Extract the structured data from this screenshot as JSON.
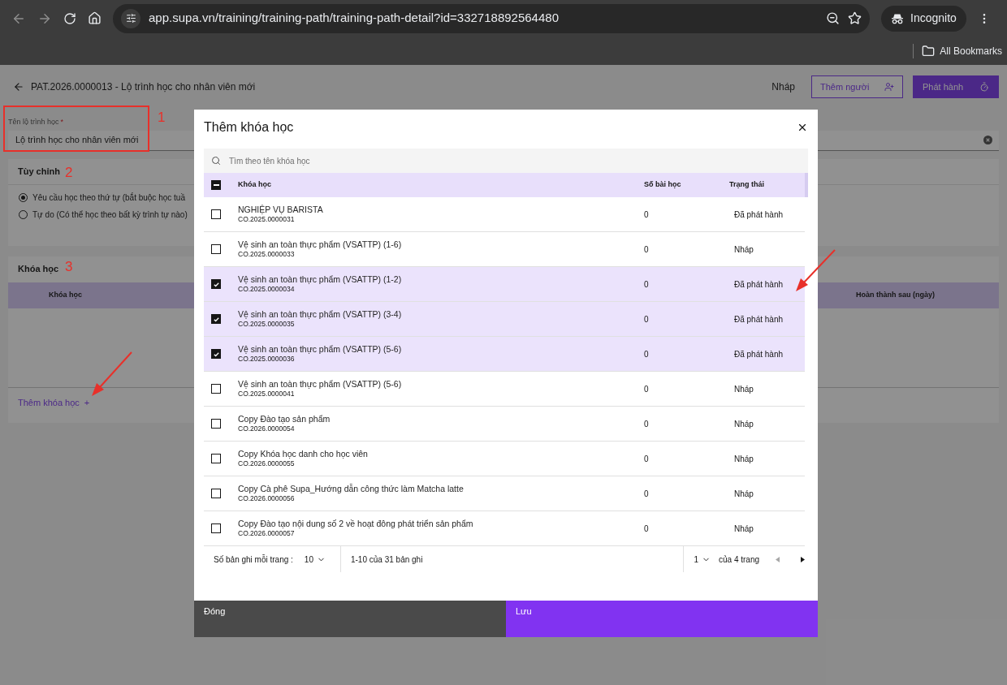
{
  "browser": {
    "url": "app.supa.vn/training/training-path/training-path-detail?id=332718892564480",
    "profile": "Incognito",
    "bookmarks": "All Bookmarks"
  },
  "page": {
    "title": "PAT.2026.0000013 - Lộ trình học cho nhân viên mới",
    "status": "Nháp",
    "add_people_button": "Thêm người",
    "publish_button": "Phát hành",
    "name_field": {
      "label": "Tên lộ trình học",
      "required_mark": "*",
      "value": "Lộ trình học cho nhân viên mới",
      "annotation_number": "1"
    },
    "options_card": {
      "title": "Tùy chỉnh",
      "annotation_number": "2",
      "options": [
        {
          "label": "Yêu cầu học theo thứ tự (bắt buộc học tuầ",
          "selected": true
        },
        {
          "label": "Tự do (Có thể học theo bất kỳ trình tự nào)",
          "selected": false
        }
      ]
    },
    "courses_card": {
      "title": "Khóa học",
      "annotation_number": "3",
      "columns": [
        "Khóa học",
        "Hoàn thành sau (ngày)"
      ],
      "add_link": "Thêm khóa học",
      "add_icon": "+"
    }
  },
  "dialog": {
    "title": "Thêm khóa học",
    "search": {
      "placeholder": "Tìm theo tên khóa học"
    },
    "select_all": {
      "indeterminate": true
    },
    "columns": [
      "Khóa học",
      "Số bài học",
      "Trạng thái"
    ],
    "rows": [
      {
        "name": "NGHIỆP VỤ BARISTA",
        "code": "CO.2025.0000031",
        "lessons": "0",
        "status": "Đã phát hành",
        "selected": false
      },
      {
        "name": "Vệ sinh an toàn thực phẩm (VSATTP) (1-6)",
        "code": "CO.2025.0000033",
        "lessons": "0",
        "status": "Nháp",
        "selected": false
      },
      {
        "name": "Vệ sinh an toàn thực phẩm (VSATTP) (1-2)",
        "code": "CO.2025.0000034",
        "lessons": "0",
        "status": "Đã phát hành",
        "selected": true
      },
      {
        "name": "Vệ sinh an toàn thực phẩm (VSATTP) (3-4)",
        "code": "CO.2025.0000035",
        "lessons": "0",
        "status": "Đã phát hành",
        "selected": true
      },
      {
        "name": "Vệ sinh an toàn thực phẩm (VSATTP) (5-6)",
        "code": "CO.2025.0000036",
        "lessons": "0",
        "status": "Đã phát hành",
        "selected": true
      },
      {
        "name": "Vệ sinh an toàn thực phẩm (VSATTP) (5-6)",
        "code": "CO.2025.0000041",
        "lessons": "0",
        "status": "Nháp",
        "selected": false
      },
      {
        "name": "Copy Đào tạo sản phẩm",
        "code": "CO.2026.0000054",
        "lessons": "0",
        "status": "Nháp",
        "selected": false
      },
      {
        "name": "Copy Khóa học danh cho học viên",
        "code": "CO.2026.0000055",
        "lessons": "0",
        "status": "Nháp",
        "selected": false
      },
      {
        "name": "Copy Cà phê Supa_Hướng dẫn công thức làm Matcha latte",
        "code": "CO.2026.0000056",
        "lessons": "0",
        "status": "Nháp",
        "selected": false
      },
      {
        "name": "Copy Đào tạo nội dung số 2 về hoạt đông phát triển sản phẩm",
        "code": "CO.2026.0000057",
        "lessons": "0",
        "status": "Nháp",
        "selected": false
      }
    ],
    "pagination": {
      "page_size_label": "Số bản ghi mỗi trang :",
      "page_size": "10",
      "range": "1-10 của 31 bản ghi",
      "page": "1",
      "page_total": "của 4 trang",
      "prev_disabled": true,
      "next_disabled": false
    },
    "close_button": "Đóng",
    "save_button": "Lưu"
  }
}
